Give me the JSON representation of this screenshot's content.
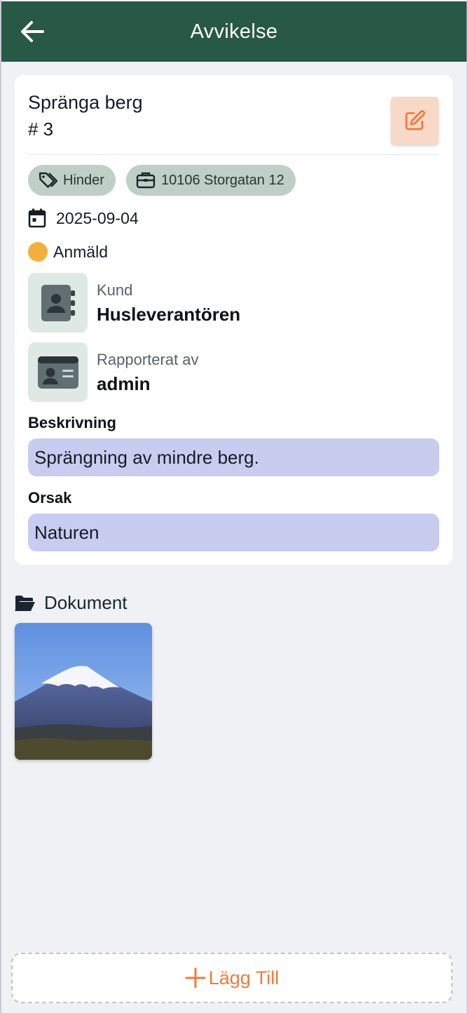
{
  "header": {
    "title": "Avvikelse"
  },
  "deviation": {
    "title": "Spränga berg",
    "number": "# 3",
    "tags": {
      "category": "Hinder",
      "project": "10106 Storgatan 12"
    },
    "date": "2025-09-04",
    "status": {
      "label": "Anmäld",
      "color": "#f4ae3c"
    },
    "customer": {
      "label": "Kund",
      "value": "Husleverantören"
    },
    "reporter": {
      "label": "Rapporterat av",
      "value": "admin"
    },
    "description": {
      "label": "Beskrivning",
      "value": "Sprängning av mindre berg."
    },
    "cause": {
      "label": "Orsak",
      "value": "Naturen"
    }
  },
  "documents": {
    "title": "Dokument",
    "items": [
      {
        "type": "image",
        "subject": "snow-capped-mountain"
      }
    ]
  },
  "footer": {
    "add_label": "Lägg Till"
  },
  "colors": {
    "appbar": "#285846",
    "accent": "#f07a3a",
    "chip": "#bfcfc8",
    "textbox": "#c8cdf0",
    "edit_button": "#f8d8c7"
  }
}
